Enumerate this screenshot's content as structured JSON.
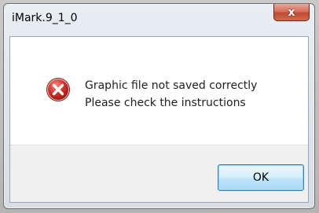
{
  "dialog": {
    "title": "iMark.9_1_0",
    "close_label": "x",
    "icon": "error-icon",
    "message_lines": [
      "Graphic file not saved correctly",
      "Please check the instructions"
    ],
    "ok_label": "OK"
  },
  "colors": {
    "error_red": "#c9302c",
    "ok_border": "#3c7fb1",
    "close_red": "#c24a32"
  }
}
